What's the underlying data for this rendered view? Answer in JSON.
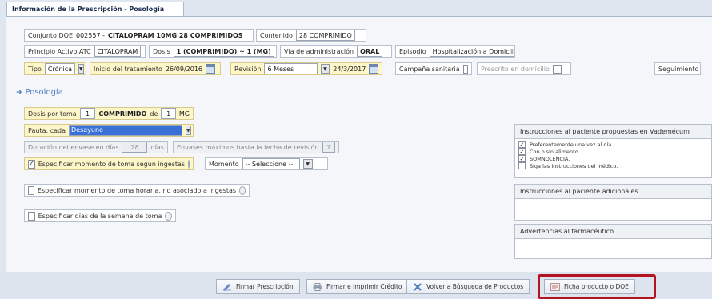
{
  "tab_title": "Información de la Prescripción - Posología",
  "row1": {
    "conjunto_label": "Conjunto DOE",
    "conjunto_code": "002557 -",
    "conjunto_name": "CITALOPRAM 10MG 28 COMPRIMIDOS",
    "contenido_label": "Contenido",
    "contenido_value": "28 COMPRIMIDO"
  },
  "row2": {
    "principio_label": "Principio Activo ATC",
    "principio_value": "CITALOPRAM",
    "dosis_label": "Dosis",
    "dosis_value": "1 (COMPRIMIDO) ~ 1 (MG)",
    "via_label": "Vía de administración",
    "via_value": "ORAL",
    "episodio_label": "Episodio",
    "episodio_value": "Hospitalización a Domicilio"
  },
  "row3": {
    "tipo_label": "Tipo",
    "tipo_value": "Crónica",
    "inicio_label": "Inicio del tratamiento",
    "inicio_value": "26/09/2016",
    "revision_label": "Revisión",
    "revision_value": "6 Meses",
    "revision_date": "24/3/2017",
    "campana_label": "Campaña sanitaria",
    "prescrito_label": "Prescrito en domicilio",
    "seguimiento_label": "Seguimiento"
  },
  "posologia": {
    "section_title": "Posología",
    "dosis_por_toma_label": "Dosis por toma",
    "dosis_qty": "1",
    "dosis_unit": "COMPRIMIDO",
    "dosis_equals": "de",
    "dosis_mg_qty": "1",
    "dosis_mg_unit": "MG",
    "pauta_label": "Pauta: cada",
    "pauta_value": "Desayuno",
    "duracion_label": "Duración del envase en días",
    "duracion_value": "28",
    "duracion_unit": "días",
    "envases_label": "Envases máximos hasta la fecha de revisión",
    "envases_value": "7",
    "especificar_ingestas_label": "Especificar momento de toma según ingestas",
    "momento_label": "Momento",
    "momento_value": "-- Seleccione --",
    "especificar_horaria_label": "Especificar momento de toma horaria, no asociado a ingestas",
    "especificar_dias_label": "Especificar días de la semana de toma"
  },
  "right_panels": {
    "vademecum_title": "Instrucciones al paciente propuestas en Vademécum",
    "vademecum_items": [
      {
        "text": "Preferentemente una vez al día.",
        "checked": true
      },
      {
        "text": "Con o sin alimento.",
        "checked": true
      },
      {
        "text": "SOMNOLENCIA.",
        "checked": true
      },
      {
        "text": "Siga las instrucciones del médico.",
        "checked": false
      }
    ],
    "adicionales_title": "Instrucciones al paciente adicionales",
    "advertencias_title": "Advertencias al farmacéutico"
  },
  "footer": {
    "firmar_label": "Firmar Prescripción",
    "firmar_imprimir_label": "Firmar e imprimir Crédito",
    "volver_label": "Volver a Búsqueda de Productos",
    "ficha_label": "Ficha producto o DOE"
  },
  "colors": {
    "highlight": "#b3141f",
    "accent": "#4a7fbf",
    "yellow_field": "#fdf6c8"
  }
}
